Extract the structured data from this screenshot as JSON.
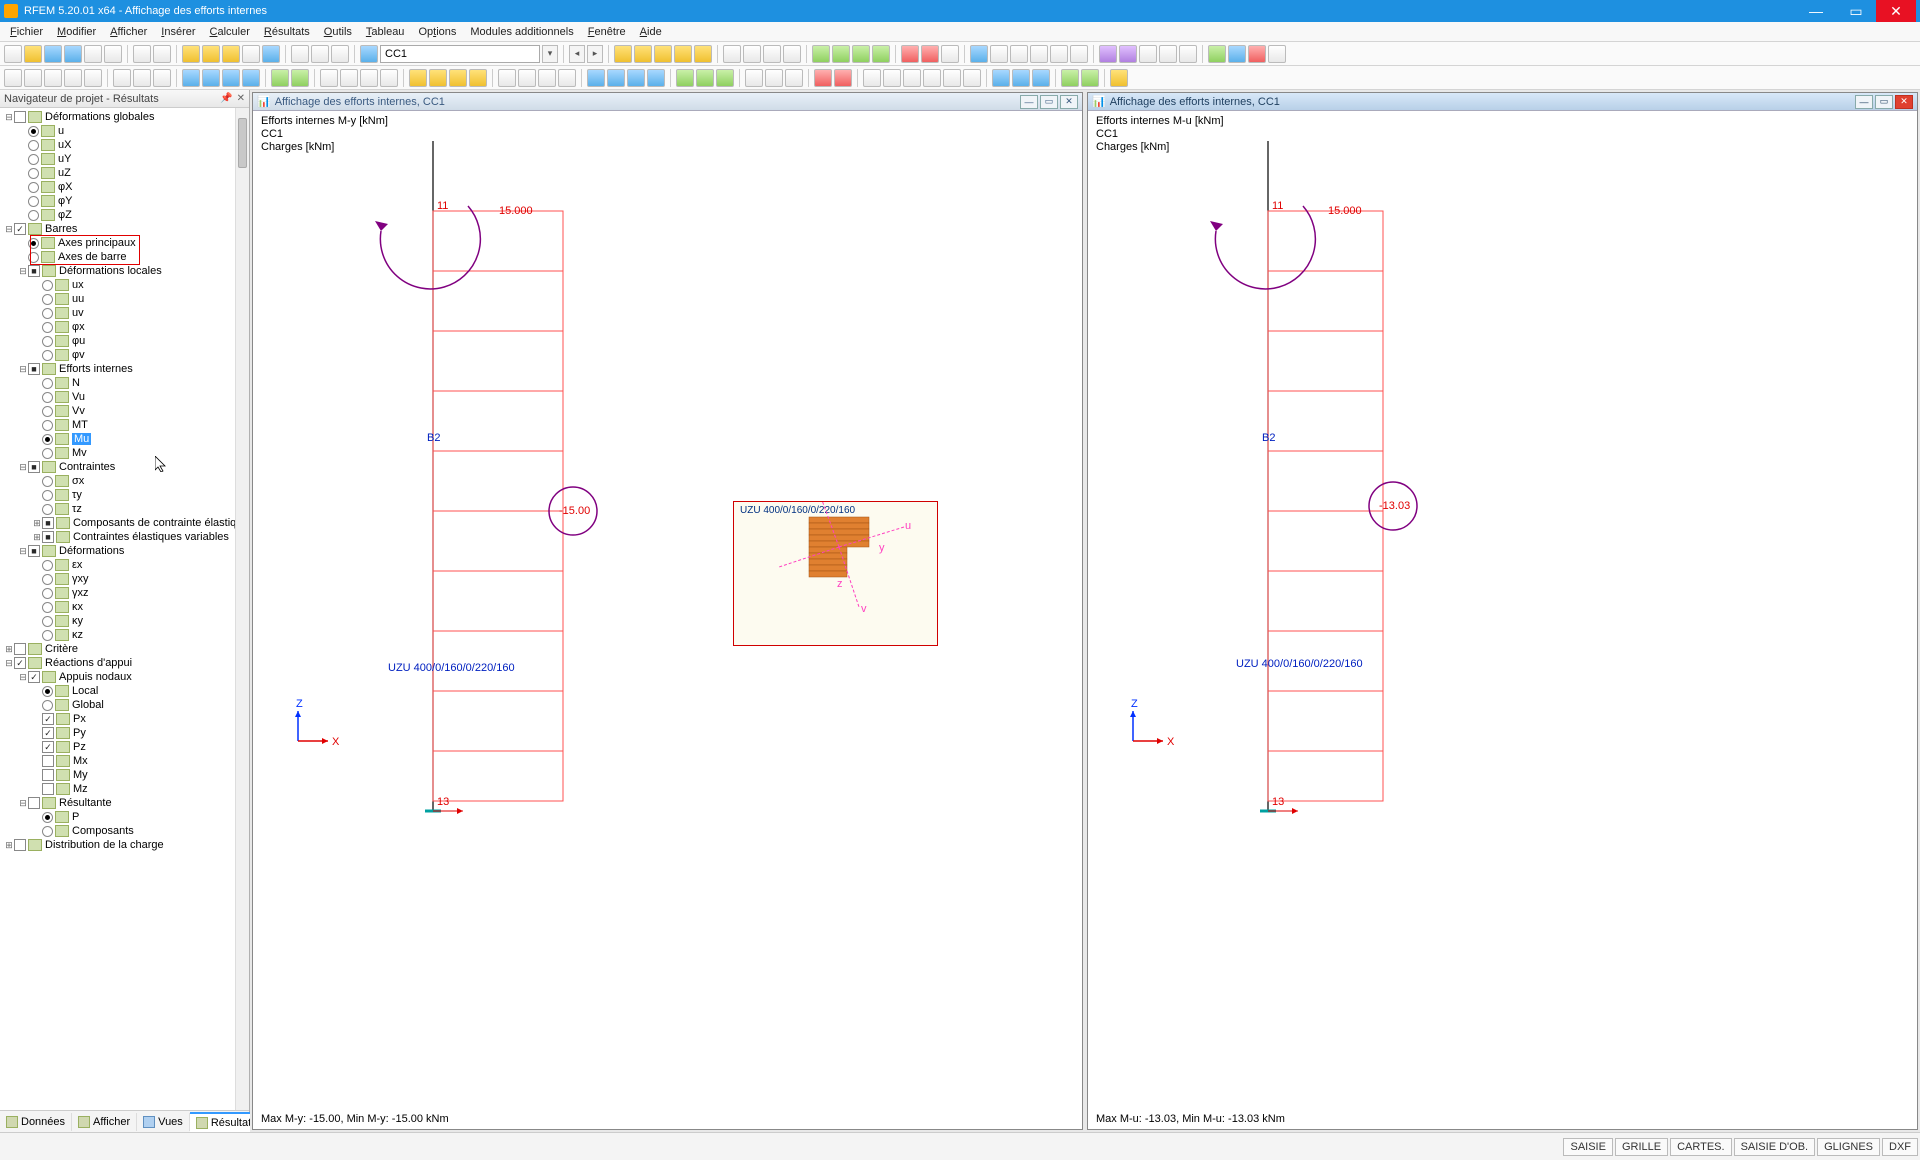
{
  "app": {
    "title": "RFEM 5.20.01 x64 - Affichage des efforts internes"
  },
  "menu": [
    "Fichier",
    "Modifier",
    "Afficher",
    "Insérer",
    "Calculer",
    "Résultats",
    "Outils",
    "Tableau",
    "Options",
    "Modules additionnels",
    "Fenêtre",
    "Aide"
  ],
  "combo_cc": "CC1",
  "navigator": {
    "title": "Navigateur de projet - Résultats",
    "tabs": [
      {
        "label": "Données"
      },
      {
        "label": "Afficher"
      },
      {
        "label": "Vues"
      },
      {
        "label": "Résultats",
        "active": true
      }
    ],
    "groups": {
      "defglob": {
        "label": "Déformations globales",
        "items": [
          "u",
          "uX",
          "uY",
          "uZ",
          "φX",
          "φY",
          "φZ"
        ]
      },
      "barres": {
        "label": "Barres",
        "axes": [
          "Axes principaux",
          "Axes de barre"
        ]
      },
      "defloc": {
        "label": "Déformations locales",
        "items": [
          "ux",
          "uu",
          "uv",
          "φx",
          "φu",
          "φv"
        ]
      },
      "eff": {
        "label": "Efforts internes",
        "items": [
          "N",
          "Vu",
          "Vv",
          "MT",
          "Mu",
          "Mv"
        ],
        "sel": "Mu"
      },
      "contr": {
        "label": "Contraintes",
        "items": [
          "σx",
          "τy",
          "τz"
        ],
        "sub": [
          "Composants de contrainte élastique",
          "Contraintes élastiques variables"
        ]
      },
      "defs": {
        "label": "Déformations",
        "items": [
          "εx",
          "γxy",
          "γxz",
          "κx",
          "κy",
          "κz"
        ]
      },
      "critere": "Critère",
      "reac": {
        "label": "Réactions d'appui"
      },
      "appnod": {
        "label": "Appuis nodaux",
        "items": [
          "Local",
          "Global",
          "Px",
          "Py",
          "Pz",
          "Mx",
          "My",
          "Mz"
        ]
      },
      "result": {
        "label": "Résultante",
        "items": [
          "P",
          "Composants"
        ]
      },
      "distrib": "Distribution de la charge"
    }
  },
  "view1": {
    "title": "Affichage des efforts internes, CC1",
    "note1": "Efforts internes M-y [kNm]",
    "note2": "CC1",
    "note3": "Charges [kNm]",
    "b2": "B2",
    "top_val": "15.000",
    "top_node": "11",
    "mid_val": "-15.00",
    "bot_node": "13",
    "section": "UZU 400/0/160/0/220/160",
    "footer": "Max M-y: -15.00, Min M-y: -15.00 kNm"
  },
  "view2": {
    "title": "Affichage des efforts internes, CC1",
    "note1": "Efforts internes M-u [kNm]",
    "note2": "CC1",
    "note3": "Charges [kNm]",
    "b2": "B2",
    "top_val": "15.000",
    "top_node": "11",
    "mid_val": "-13.03",
    "bot_node": "13",
    "section": "UZU 400/0/160/0/220/160",
    "footer": "Max M-u: -13.03, Min M-u: -13.03 kNm"
  },
  "profile_popup": {
    "title": "UZU 400/0/160/0/220/160"
  },
  "status": [
    "SAISIE",
    "GRILLE",
    "CARTES.",
    "SAISIE D'OB.",
    "GLIGNES",
    "DXF"
  ]
}
